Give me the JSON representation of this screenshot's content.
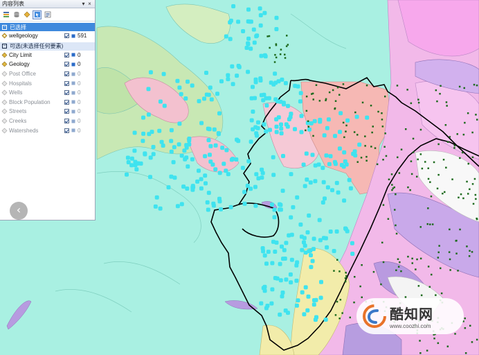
{
  "panel": {
    "title": "内容列表",
    "pin_glyph": "▾",
    "close_glyph": "×",
    "toolbar": [
      {
        "name": "list-by-drawing-order-button",
        "icon": "layers-list-icon"
      },
      {
        "name": "list-by-source-button",
        "icon": "database-icon"
      },
      {
        "name": "list-by-visibility-button",
        "icon": "visibility-icon"
      },
      {
        "name": "list-by-selection-button",
        "icon": "selection-list-icon",
        "active": true
      },
      {
        "name": "options-button",
        "icon": "options-icon"
      }
    ],
    "selected_group": {
      "label": "已选择",
      "toggle": "−"
    },
    "selected_layers": [
      {
        "name": "wellgeology",
        "count": "591",
        "active": true
      }
    ],
    "selectable_group": {
      "label": "可选(未选择任何要素)",
      "toggle": "−"
    },
    "selectable_layers": [
      {
        "name": "City Limit",
        "count": "0",
        "active": true
      },
      {
        "name": "Geology",
        "count": "0",
        "active": true
      },
      {
        "name": "Post Office",
        "count": "0",
        "active": false
      },
      {
        "name": "Hospitals",
        "count": "0",
        "active": false
      },
      {
        "name": "Wells",
        "count": "0",
        "active": false
      },
      {
        "name": "Block Population",
        "count": "0",
        "active": false
      },
      {
        "name": "Streets",
        "count": "0",
        "active": false
      },
      {
        "name": "Creeks",
        "count": "0",
        "active": false
      },
      {
        "name": "Watersheds",
        "count": "0",
        "active": false
      }
    ]
  },
  "nav": {
    "back_glyph": "‹",
    "icon": "chevron-left-icon"
  },
  "watermark": {
    "brand": "酷知网",
    "url": "www.coozhi.com"
  },
  "colors": {
    "map_base": "#a9f0e2",
    "green_geology": "#c8e8b4",
    "pink_geology": "#f3c1cf",
    "salmon_geology": "#f6b8b4",
    "magenta_geology": "#f2b9e9",
    "purple_geology": "#c9a9ea",
    "yellow_geology": "#f2ecaa",
    "white_geology": "#f8f8f8",
    "well_points": "#3fe3ef",
    "green_points": "#1e6b1e",
    "city_limit": "#000000",
    "selected_group_bg": "#3f89dd",
    "selectable_group_bg": "#dce7f7"
  }
}
